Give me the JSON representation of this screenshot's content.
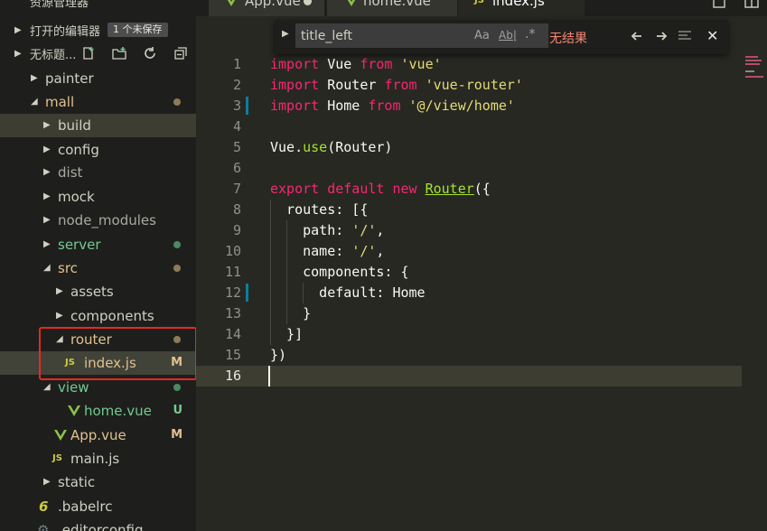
{
  "sidebar": {
    "title": "资源管理器",
    "open_editors": "打开的编辑器",
    "unsaved_badge": "1 个未保存",
    "workspace": "无标题...",
    "tree": [
      {
        "name": "painter"
      },
      {
        "name": "mall"
      },
      {
        "name": "build"
      },
      {
        "name": "config"
      },
      {
        "name": "dist"
      },
      {
        "name": "mock"
      },
      {
        "name": "node_modules"
      },
      {
        "name": "server"
      },
      {
        "name": "src"
      },
      {
        "name": "assets"
      },
      {
        "name": "components"
      },
      {
        "name": "router"
      },
      {
        "name": "index.js",
        "status": "M",
        "icon": "JS"
      },
      {
        "name": "view"
      },
      {
        "name": "home.vue",
        "status": "U"
      },
      {
        "name": "App.vue",
        "status": "M"
      },
      {
        "name": "main.js",
        "icon": "JS"
      },
      {
        "name": "static"
      },
      {
        "name": ".babelrc",
        "icon": "6"
      },
      {
        "name": ".editorconfig"
      }
    ]
  },
  "tabs": [
    {
      "label": "App.vue"
    },
    {
      "label": "home.vue"
    },
    {
      "label": "index.js",
      "icon": "JS"
    }
  ],
  "find": {
    "query": "title_left",
    "match_case": "Aa",
    "whole_word": "Ab|",
    "regex": ".*",
    "result": "无结果",
    "close": "✕"
  },
  "editor": {
    "lines": [
      "1",
      "2",
      "3",
      "4",
      "5",
      "6",
      "7",
      "8",
      "9",
      "10",
      "11",
      "12",
      "13",
      "14",
      "15",
      "16"
    ]
  },
  "colors": {
    "accent_red": "#e8281f",
    "modified": "#e2c08d",
    "untracked": "#73c991",
    "keyword": "#f92672",
    "string": "#e6db74",
    "function": "#a6e22e"
  }
}
